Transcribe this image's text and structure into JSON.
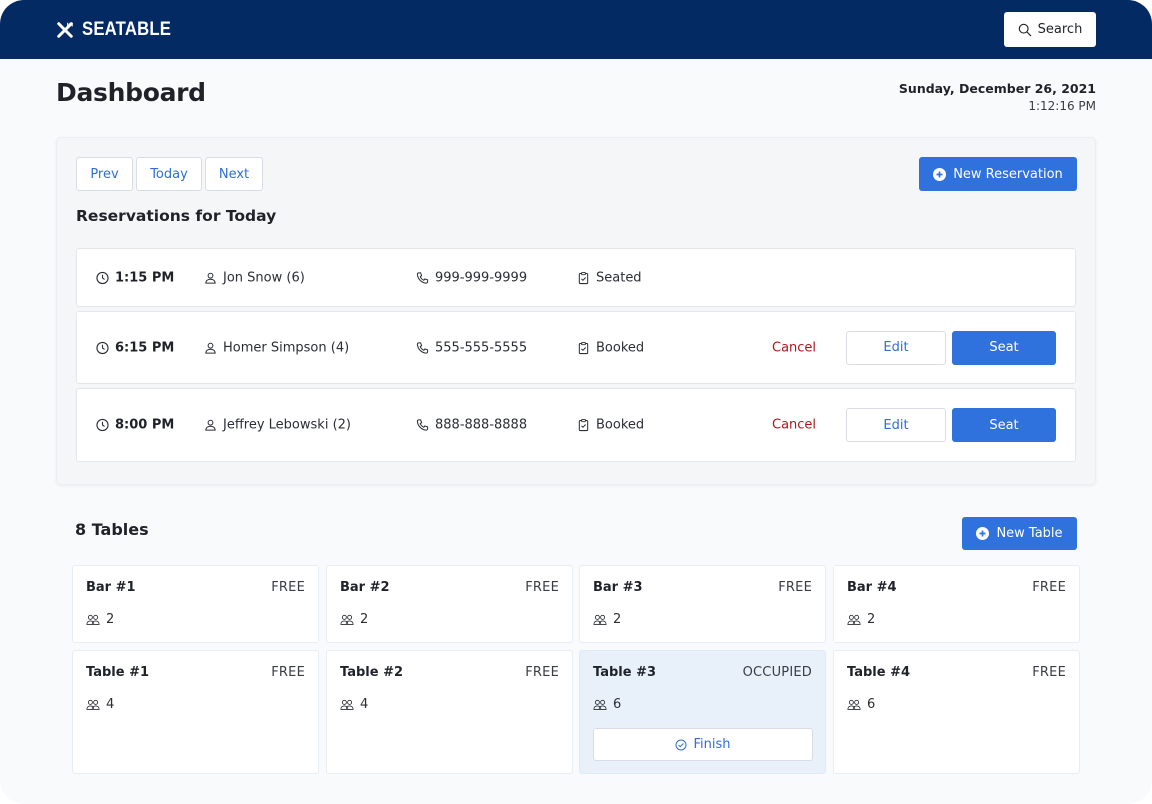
{
  "app": {
    "brand": "SEATABLE",
    "search_label": "Search"
  },
  "header": {
    "title": "Dashboard",
    "date": "Sunday, December 26, 2021",
    "time": "1:12:16 PM"
  },
  "reservations": {
    "nav": {
      "prev_label": "Prev",
      "today_label": "Today",
      "next_label": "Next"
    },
    "new_button_label": "New Reservation",
    "heading": "Reservations for Today",
    "cancel_label": "Cancel",
    "edit_label": "Edit",
    "seat_label": "Seat",
    "items": [
      {
        "time": "1:15 PM",
        "guest": "Jon Snow (6)",
        "phone": "999-999-9999",
        "status": "Seated",
        "actions": false
      },
      {
        "time": "6:15 PM",
        "guest": "Homer Simpson (4)",
        "phone": "555-555-5555",
        "status": "Booked",
        "actions": true
      },
      {
        "time": "8:00 PM",
        "guest": "Jeffrey Lebowski (2)",
        "phone": "888-888-8888",
        "status": "Booked",
        "actions": true
      }
    ]
  },
  "tables": {
    "heading": "8 Tables",
    "new_button_label": "New Table",
    "finish_label": "Finish",
    "items": [
      {
        "name": "Bar #1",
        "status": "FREE",
        "seats": "2"
      },
      {
        "name": "Bar #2",
        "status": "FREE",
        "seats": "2"
      },
      {
        "name": "Bar #3",
        "status": "FREE",
        "seats": "2"
      },
      {
        "name": "Bar #4",
        "status": "FREE",
        "seats": "2"
      },
      {
        "name": "Table #1",
        "status": "FREE",
        "seats": "4"
      },
      {
        "name": "Table #2",
        "status": "FREE",
        "seats": "4"
      },
      {
        "name": "Table #3",
        "status": "OCCUPIED",
        "seats": "6"
      },
      {
        "name": "Table #4",
        "status": "FREE",
        "seats": "6"
      }
    ]
  },
  "colors": {
    "brand_navy": "#042a63",
    "primary_blue": "#2f72de",
    "link_blue": "#2f6fd6",
    "cancel_red": "#b0141b",
    "occupied_bg": "#e8f0fa",
    "page_bg": "#f8fafc"
  }
}
